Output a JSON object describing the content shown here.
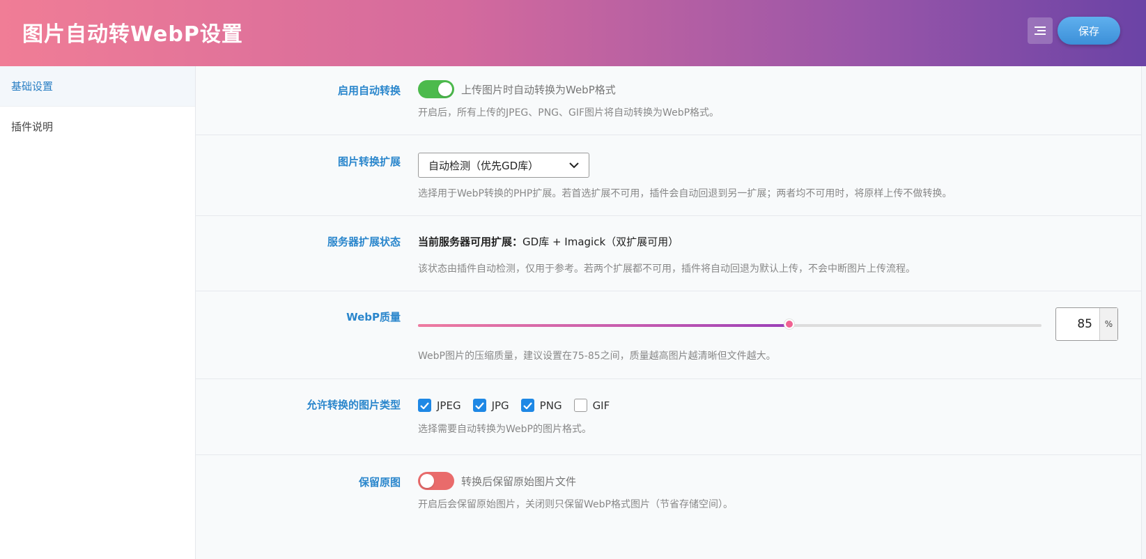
{
  "header": {
    "title": "图片自动转WebP设置",
    "menu_icon": "list-icon",
    "save_label": "保存"
  },
  "sidebar": {
    "items": [
      {
        "label": "基础设置",
        "active": true
      },
      {
        "label": "插件说明",
        "active": false
      }
    ]
  },
  "settings": {
    "auto_convert": {
      "label": "启用自动转换",
      "enabled": true,
      "toggle_text": "上传图片时自动转换为WebP格式",
      "desc": "开启后，所有上传的JPEG、PNG、GIF图片将自动转换为WebP格式。"
    },
    "extension": {
      "label": "图片转换扩展",
      "selected": "自动检测（优先GD库）",
      "desc": "选择用于WebP转换的PHP扩展。若首选扩展不可用，插件会自动回退到另一扩展；两者均不可用时，将原样上传不做转换。"
    },
    "server_status": {
      "label": "服务器扩展状态",
      "status_key": "当前服务器可用扩展：",
      "status_value": "GD库 + Imagick（双扩展可用）",
      "desc": "该状态由插件自动检测，仅用于参考。若两个扩展都不可用，插件将自动回退为默认上传，不会中断图片上传流程。"
    },
    "quality": {
      "label": "WebP质量",
      "value": "85",
      "min": 0,
      "max": 100,
      "unit": "%",
      "desc": "WebP图片的压缩质量，建议设置在75-85之间，质量越高图片越清晰但文件越大。"
    },
    "types": {
      "label": "允许转换的图片类型",
      "options": [
        {
          "label": "JPEG",
          "checked": true
        },
        {
          "label": "JPG",
          "checked": true
        },
        {
          "label": "PNG",
          "checked": true
        },
        {
          "label": "GIF",
          "checked": false
        }
      ],
      "desc": "选择需要自动转换为WebP的图片格式。"
    },
    "keep_original": {
      "label": "保留原图",
      "enabled": false,
      "toggle_text": "转换后保留原始图片文件",
      "desc": "开启后会保留原始图片，关闭则只保留WebP格式图片（节省存储空间）。"
    }
  },
  "colors": {
    "accent": "#2a86cc",
    "toggle_on": "#4cba4c",
    "toggle_off": "#e96b6b",
    "checkbox": "#1e88e5"
  }
}
